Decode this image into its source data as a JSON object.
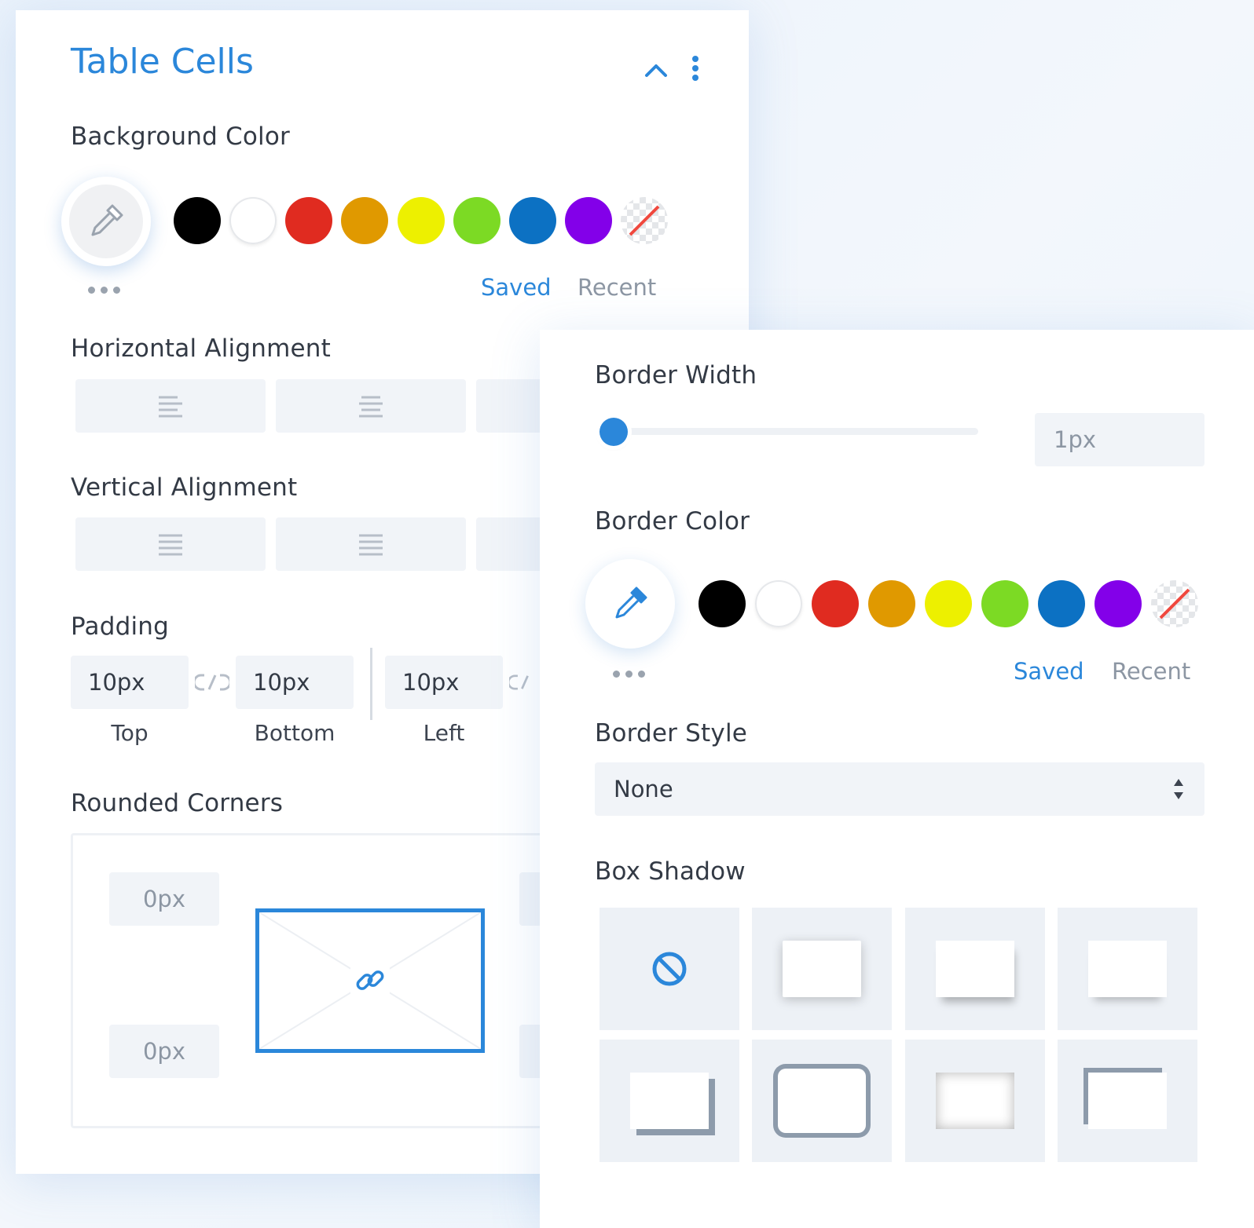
{
  "left_panel": {
    "title": "Table Cells",
    "background_color_label": "Background Color",
    "swatches": [
      "#000000",
      "#ffffff",
      "#e02b20",
      "#e09900",
      "#edf000",
      "#7cda24",
      "#0c71c3",
      "#8300e9"
    ],
    "saved_tab": "Saved",
    "recent_tab": "Recent",
    "horizontal_alignment_label": "Horizontal Alignment",
    "vertical_alignment_label": "Vertical Alignment",
    "padding_label": "Padding",
    "padding": {
      "top_value": "10px",
      "top_label": "Top",
      "bottom_value": "10px",
      "bottom_label": "Bottom",
      "left_value": "10px",
      "left_label": "Left"
    },
    "rounded_corners_label": "Rounded Corners",
    "corners": {
      "top_left": "0px",
      "bottom_left": "0px"
    }
  },
  "right_panel": {
    "border_width_label": "Border Width",
    "border_width_value": "1px",
    "border_width_slider_fraction": 0.0,
    "border_color_label": "Border Color",
    "swatches": [
      "#000000",
      "#ffffff",
      "#e02b20",
      "#e09900",
      "#edf000",
      "#7cda24",
      "#0c71c3",
      "#8300e9"
    ],
    "saved_tab": "Saved",
    "recent_tab": "Recent",
    "border_style_label": "Border Style",
    "border_style_value": "None",
    "box_shadow_label": "Box Shadow"
  },
  "colors": {
    "accent": "#2b87da",
    "muted_tab": "#8c96a3"
  }
}
